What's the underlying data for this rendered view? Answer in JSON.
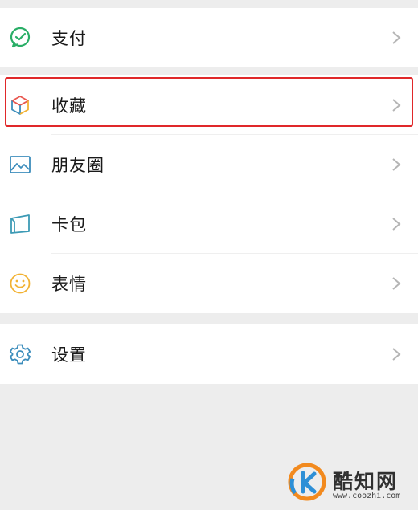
{
  "groups": [
    {
      "items": [
        {
          "label": "支付",
          "icon": "wechat-pay-icon"
        }
      ]
    },
    {
      "items": [
        {
          "label": "收藏",
          "icon": "favorites-cube-icon"
        },
        {
          "label": "朋友圈",
          "icon": "moments-photo-icon"
        },
        {
          "label": "卡包",
          "icon": "card-wallet-icon"
        },
        {
          "label": "表情",
          "icon": "sticker-smile-icon"
        }
      ]
    },
    {
      "items": [
        {
          "label": "设置",
          "icon": "gear-icon"
        }
      ]
    }
  ],
  "highlighted_item": "收藏",
  "colors": {
    "background": "#ededed",
    "highlight_border": "#e0282a",
    "pay_green": "#2aae67",
    "icon_blue": "#3c8dbc"
  },
  "watermark": {
    "name": "酷知网",
    "url": "www.coozhi.com"
  }
}
